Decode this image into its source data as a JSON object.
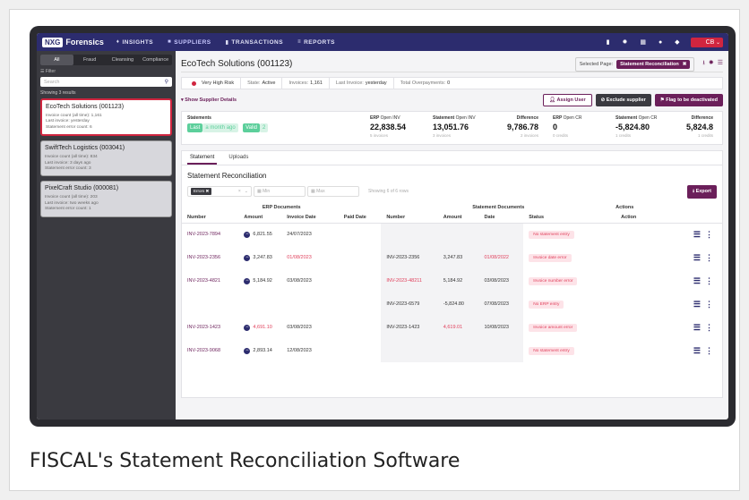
{
  "nav": {
    "brand_badge": "NXG",
    "brand_name": "Forensics",
    "items": [
      {
        "label": "INSIGHTS",
        "icon": "bulb-icon",
        "glyph": "♦"
      },
      {
        "label": "SUPPLIERS",
        "icon": "suppliers-icon",
        "glyph": "■"
      },
      {
        "label": "TRANSACTIONS",
        "icon": "doc-icon",
        "glyph": "▮"
      },
      {
        "label": "REPORTS",
        "icon": "grid-icon",
        "glyph": "≡"
      }
    ],
    "avatar": "CB",
    "right_icons": [
      "doc-icon",
      "gear-icon",
      "calendar-icon",
      "help-icon",
      "chat-icon"
    ]
  },
  "sidebar": {
    "tabs": [
      "All",
      "Fraud",
      "Cleansing",
      "Compliance"
    ],
    "filter_label": "☰ Filter",
    "search_placeholder": "Search",
    "results_text": "Showing 3 results",
    "suppliers": [
      {
        "name": "EcoTech Solutions (001123)",
        "lines": [
          "Invoice count (all time): 1,161",
          "Last invoice: yesterday",
          "Statement error count: 6"
        ]
      },
      {
        "name": "SwiftTech Logistics (003041)",
        "lines": [
          "Invoice count (all time): 834",
          "Last invoice: 3 days ago",
          "Statement error count: 3"
        ]
      },
      {
        "name": "PixelCraft Studio (000081)",
        "lines": [
          "Invoice count (all time): 203",
          "Last invoice: two weeks ago",
          "Statement error count: 1"
        ]
      }
    ]
  },
  "header": {
    "title": "EcoTech Solutions (001123)",
    "selected_page_label": "Selected Page:",
    "selected_page_value": "Statement Reconciliation"
  },
  "risk": {
    "level": "Very High Risk",
    "state_label": "State:",
    "state_value": "Active",
    "invoices_label": "Invoices:",
    "invoices_value": "1,161",
    "last_invoice_label": "Last Invoice:",
    "last_invoice_value": "yesterday",
    "overpay_label": "Total Overpayments:",
    "overpay_value": "0"
  },
  "actions": {
    "show_details": "▾ Show Supplier Details",
    "assign_user": "Assign User",
    "exclude": "Exclude supplier",
    "flag": "Flag to be deactivated"
  },
  "summary": {
    "statements_label": "Statements",
    "last_pill": "Last",
    "last_value": "a month ago",
    "valid_pill": "Valid",
    "valid_value": "2",
    "blocks": [
      {
        "title": "ERP",
        "title_rest": "Open INV",
        "value": "22,838.54",
        "sub": "5 invoices"
      },
      {
        "title": "Statement",
        "title_rest": "Open INV",
        "value": "13,051.76",
        "sub": "3 invoices"
      },
      {
        "title": "Difference",
        "title_rest": "",
        "value": "9,786.78",
        "sub": "2 invoices"
      },
      {
        "title": "ERP",
        "title_rest": "Open CR",
        "value": "0",
        "sub": "0 credits"
      },
      {
        "title": "Statement",
        "title_rest": "Open CR",
        "value": "-5,824.80",
        "sub": "1 credits"
      },
      {
        "title": "Difference",
        "title_rest": "",
        "value": "5,824.8",
        "sub": "1 credits"
      }
    ]
  },
  "panel": {
    "tabs": [
      "Statement",
      "Uploads"
    ],
    "title": "Statement Reconciliation",
    "error_chip": "Errors",
    "min_placeholder": "Min",
    "max_placeholder": "Max",
    "showing": "Showing 6 of 6 rows",
    "export": "Export"
  },
  "table": {
    "group_erp": "ERP Documents",
    "group_statement": "Statement Documents",
    "group_actions": "Actions",
    "columns": [
      "Number",
      "Amount",
      "Invoice Date",
      "Paid Date",
      "Number",
      "Amount",
      "Date",
      "Status",
      "Action"
    ],
    "rows": [
      {
        "erp_num": "INV-2023-7894",
        "erp_amt": "6,821.55",
        "erp_amt_red": false,
        "erp_date": "24/07/2023",
        "erp_date_red": false,
        "st_num": "",
        "st_num_red": false,
        "st_amt": "",
        "st_amt_red": false,
        "st_date": "",
        "st_date_red": false,
        "status": "No statement entry"
      },
      {
        "erp_num": "INV-2023-2356",
        "erp_amt": "3,247.83",
        "erp_amt_red": false,
        "erp_date": "01/08/2023",
        "erp_date_red": true,
        "st_num": "INV-2023-2356",
        "st_num_red": false,
        "st_amt": "3,247.83",
        "st_amt_red": false,
        "st_date": "01/08/2022",
        "st_date_red": true,
        "status": "Invoice date error"
      },
      {
        "erp_num": "INV-2023-4821",
        "erp_amt": "5,184.92",
        "erp_amt_red": false,
        "erp_date": "03/08/2023",
        "erp_date_red": false,
        "st_num": "INV-2023-48211",
        "st_num_red": true,
        "st_amt": "5,184.92",
        "st_amt_red": false,
        "st_date": "03/08/2023",
        "st_date_red": false,
        "status": "Invoice number error"
      },
      {
        "erp_num": "",
        "erp_amt": "",
        "erp_amt_red": false,
        "erp_date": "",
        "erp_date_red": false,
        "st_num": "INV-2023-6579",
        "st_num_red": false,
        "st_amt": "-5,824.80",
        "st_amt_red": false,
        "st_date": "07/08/2023",
        "st_date_red": false,
        "status": "No ERP entry"
      },
      {
        "erp_num": "INV-2023-1423",
        "erp_amt": "4,691.10",
        "erp_amt_red": true,
        "erp_date": "03/08/2023",
        "erp_date_red": false,
        "st_num": "INV-2023-1423",
        "st_num_red": false,
        "st_amt": "4,619.01",
        "st_amt_red": true,
        "st_date": "10/08/2023",
        "st_date_red": false,
        "status": "Invoice amount error"
      },
      {
        "erp_num": "INV-2023-9068",
        "erp_amt": "2,893.14",
        "erp_amt_red": false,
        "erp_date": "12/08/2023",
        "erp_date_red": false,
        "st_num": "",
        "st_num_red": false,
        "st_amt": "",
        "st_amt_red": false,
        "st_date": "",
        "st_date_red": false,
        "status": "No statement entry"
      }
    ]
  },
  "caption": "FISCAL's Statement Reconciliation Software",
  "colors": {
    "navy": "#2c2c6e",
    "plum": "#6b1f5a",
    "red": "#d0253f",
    "green": "#5ccf9b"
  }
}
